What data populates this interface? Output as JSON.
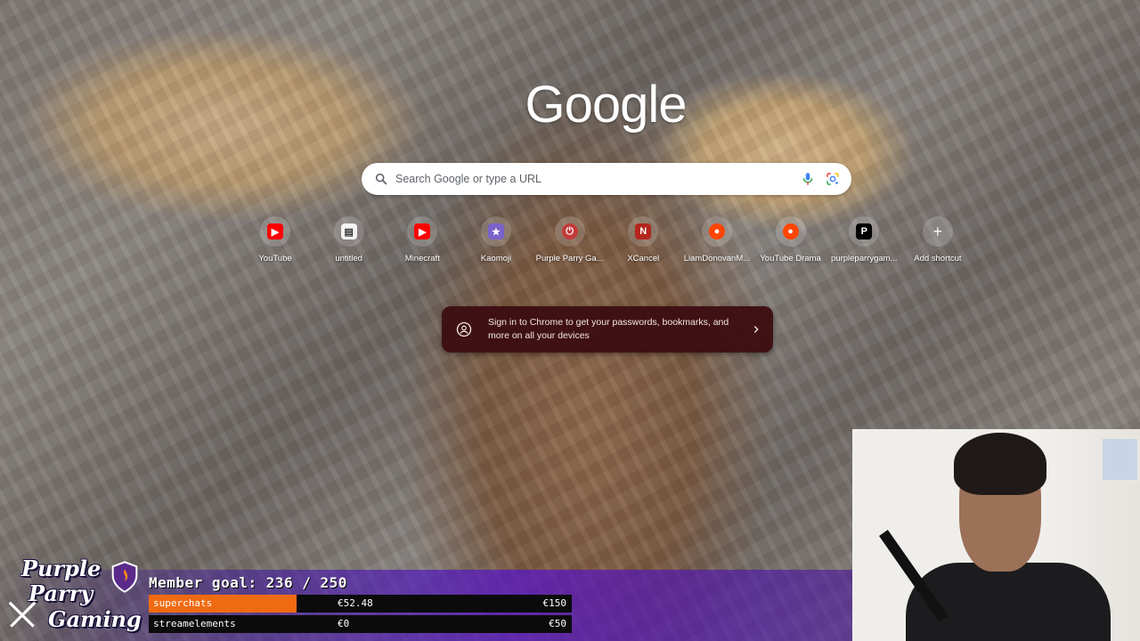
{
  "google_logo": "Google",
  "search": {
    "placeholder": "Search Google or type a URL"
  },
  "shortcuts": [
    {
      "label": "YouTube",
      "icon": "youtube-icon",
      "color": "#ff0000"
    },
    {
      "label": "untitled",
      "icon": "document-icon",
      "color": "#ffffff"
    },
    {
      "label": "Minecraft",
      "icon": "youtube-icon",
      "color": "#ff0000"
    },
    {
      "label": "Kaomoji",
      "icon": "kaomoji-icon",
      "color": "#7a62c9"
    },
    {
      "label": "Purple Parry Ga...",
      "icon": "power-icon",
      "color": "#c23b3b"
    },
    {
      "label": "XCancel",
      "icon": "n-icon",
      "color": "#b3261e"
    },
    {
      "label": "LiamDonovanM...",
      "icon": "reddit-icon",
      "color": "#ff4500"
    },
    {
      "label": "YouTube Drama",
      "icon": "reddit-icon",
      "color": "#ff4500"
    },
    {
      "label": "purpleparrygam...",
      "icon": "patreon-icon",
      "color": "#000000"
    },
    {
      "label": "Add shortcut",
      "icon": "plus-icon",
      "color": "#ffffff"
    }
  ],
  "signin_prompt": {
    "text": "Sign in to Chrome to get your passwords, bookmarks, and more on all your devices"
  },
  "overlay": {
    "logo_line1": "Purple",
    "logo_line2": "Parry",
    "logo_line3": "Gaming",
    "member_goal": "Member goal: 236 / 250",
    "bars": [
      {
        "name": "superchats",
        "current": "€52.48",
        "goal": "€150",
        "progress": 0.35,
        "color": "#f06a12"
      },
      {
        "name": "streamelements",
        "current": "€0",
        "goal": "€50",
        "progress": 0.0,
        "color": "#f06a12"
      }
    ]
  }
}
